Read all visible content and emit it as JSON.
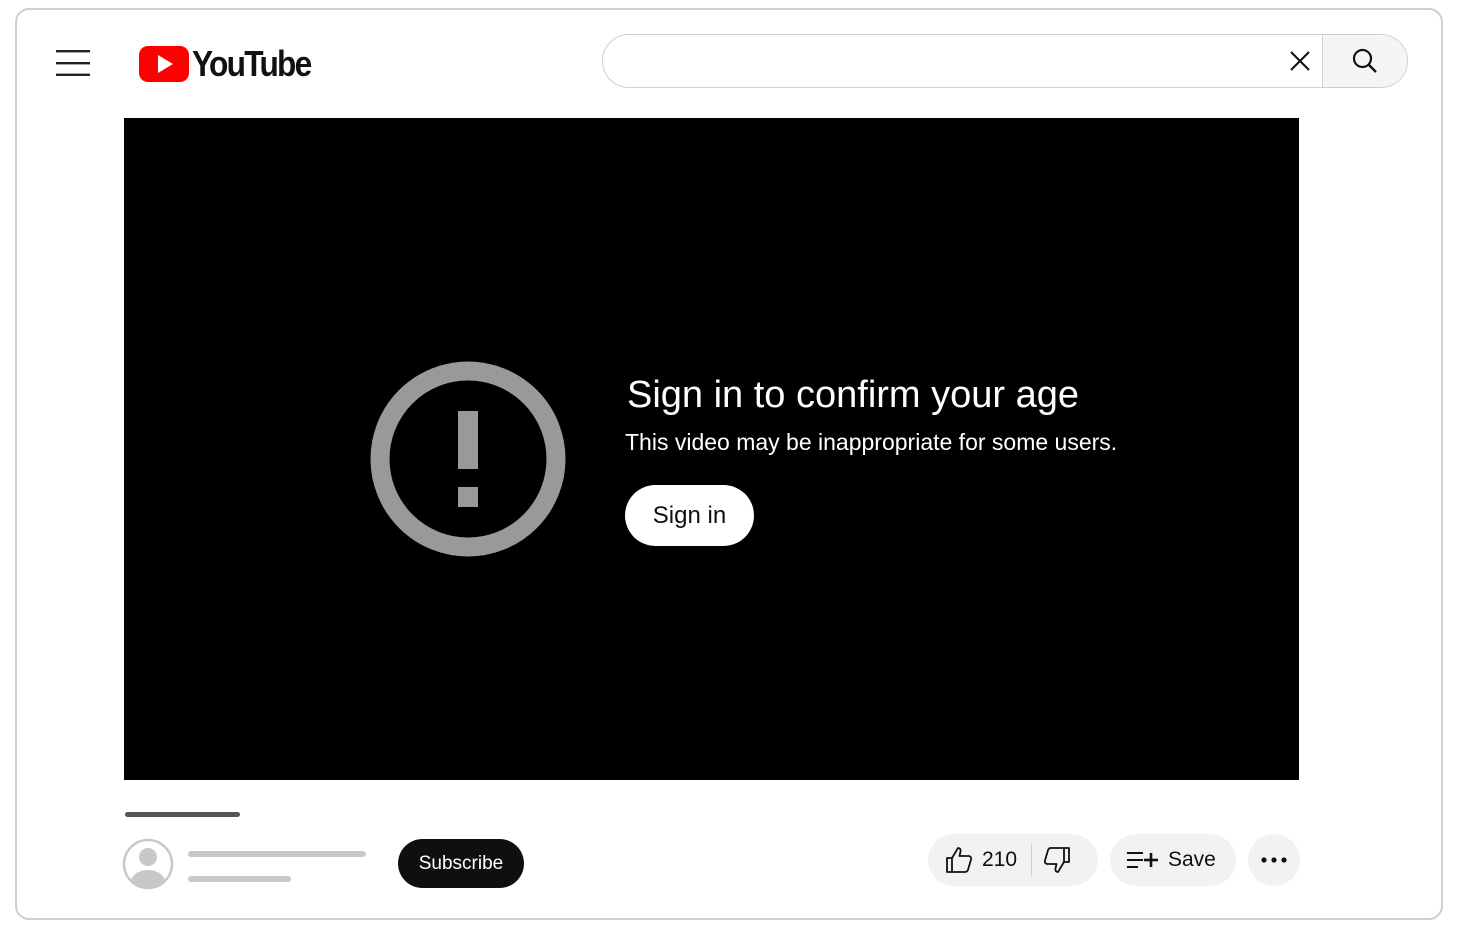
{
  "header": {
    "logo_text": "YouTube",
    "menu_icon": "hamburger-menu-icon",
    "search": {
      "value": "",
      "placeholder": ""
    },
    "clear_icon": "close-icon",
    "search_icon": "search-icon"
  },
  "player": {
    "warning_icon": "alert-circle-icon",
    "title": "Sign in to confirm your age",
    "subtitle": "This video may be inappropriate for some users.",
    "signin_label": "Sign in"
  },
  "channel": {
    "subscribe_label": "Subscribe"
  },
  "actions": {
    "like_count": "210",
    "save_label": "Save"
  },
  "colors": {
    "brand_red": "#ff0000",
    "player_bg": "#000000",
    "warning_gray": "#999999",
    "button_dark": "#0f0f0f",
    "chip_bg": "#f2f2f2"
  }
}
